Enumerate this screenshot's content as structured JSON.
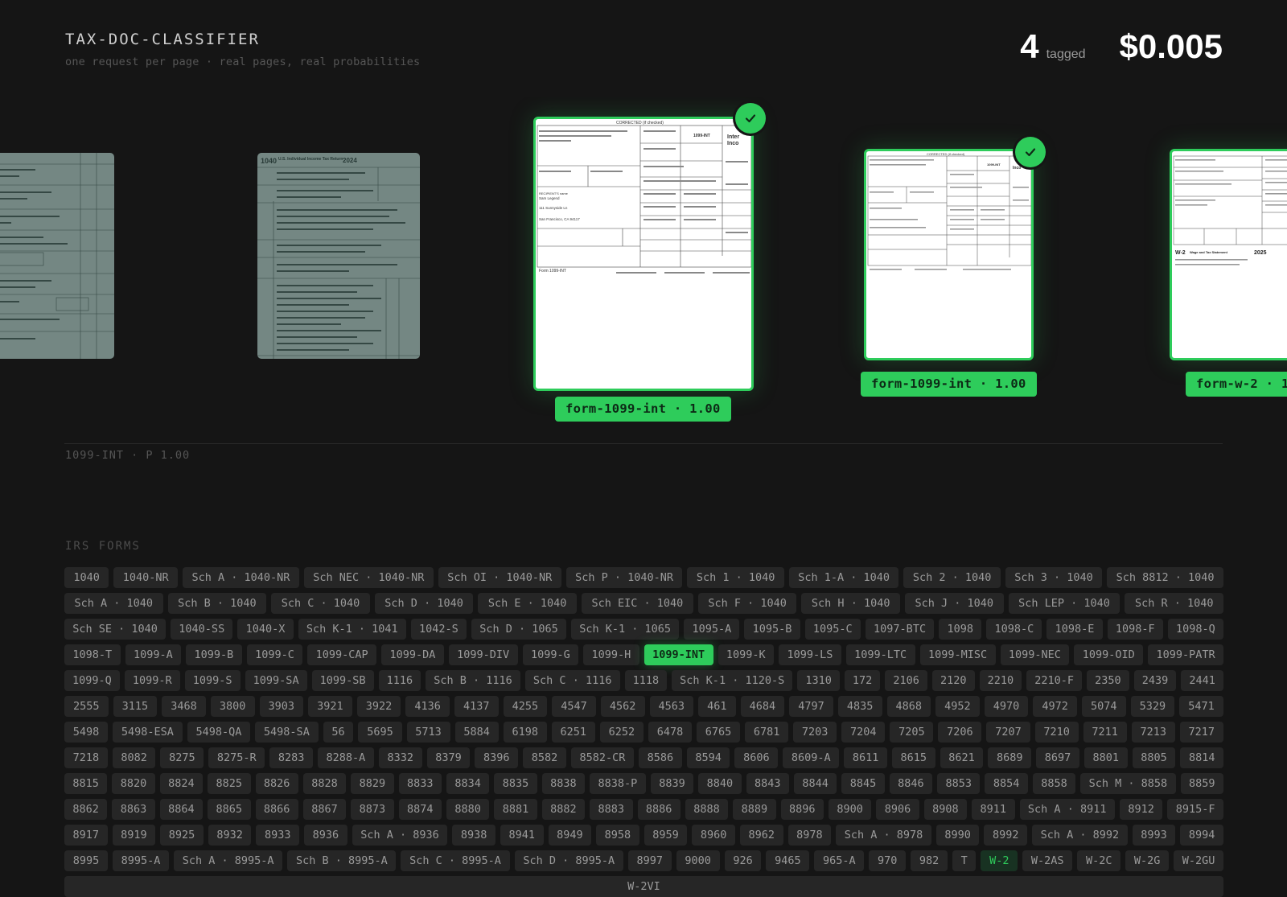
{
  "header": {
    "title": "TAX-DOC-CLASSIFIER",
    "subtitle": "one request per page · real pages, real probabilities",
    "tagged_count": "4",
    "tagged_label": "tagged",
    "cost": "$0.005"
  },
  "carousel": {
    "pages": [
      {
        "state": "dim",
        "form": "1040 page"
      },
      {
        "state": "dim",
        "form": "1040",
        "heading": "U.S. Individual Income Tax Return",
        "year": "2024"
      },
      {
        "state": "tagged-selected",
        "form": "1099-INT",
        "label": "form-1099-int · 1.00",
        "recipient": "Sam Legend",
        "street": "111 Sunnyside Ln",
        "city": "San Francisco, CA 94117"
      },
      {
        "state": "tagged",
        "form": "1099-INT",
        "label": "form-1099-int · 1.00"
      },
      {
        "state": "tagged",
        "form": "W-2",
        "label": "form-w-2 · 1",
        "heading": "Wage and Tax Statement",
        "year": "2025"
      }
    ]
  },
  "selected_readout": "1099-INT · P 1.00",
  "forms_heading": "IRS FORMS",
  "colors": {
    "accent": "#2ecc5b",
    "background": "#151515",
    "chip": "#262626"
  },
  "forms": [
    {
      "label": "1040"
    },
    {
      "label": "1040-NR"
    },
    {
      "label": "Sch A · 1040-NR"
    },
    {
      "label": "Sch NEC · 1040-NR"
    },
    {
      "label": "Sch OI · 1040-NR"
    },
    {
      "label": "Sch P · 1040-NR"
    },
    {
      "label": "Sch 1 · 1040"
    },
    {
      "label": "Sch 1-A · 1040"
    },
    {
      "label": "Sch 2 · 1040"
    },
    {
      "label": "Sch 3 · 1040"
    },
    {
      "label": "Sch 8812 · 1040"
    },
    {
      "label": "Sch A · 1040"
    },
    {
      "label": "Sch B · 1040"
    },
    {
      "label": "Sch C · 1040"
    },
    {
      "label": "Sch D · 1040"
    },
    {
      "label": "Sch E · 1040"
    },
    {
      "label": "Sch EIC · 1040"
    },
    {
      "label": "Sch F · 1040"
    },
    {
      "label": "Sch H · 1040"
    },
    {
      "label": "Sch J · 1040"
    },
    {
      "label": "Sch LEP · 1040"
    },
    {
      "label": "Sch R · 1040"
    },
    {
      "label": "Sch SE · 1040"
    },
    {
      "label": "1040-SS"
    },
    {
      "label": "1040-X"
    },
    {
      "label": "Sch K-1 · 1041"
    },
    {
      "label": "1042-S"
    },
    {
      "label": "Sch D · 1065"
    },
    {
      "label": "Sch K-1 · 1065"
    },
    {
      "label": "1095-A"
    },
    {
      "label": "1095-B"
    },
    {
      "label": "1095-C"
    },
    {
      "label": "1097-BTC"
    },
    {
      "label": "1098"
    },
    {
      "label": "1098-C"
    },
    {
      "label": "1098-E"
    },
    {
      "label": "1098-F"
    },
    {
      "label": "1098-Q"
    },
    {
      "label": "1098-T"
    },
    {
      "label": "1099-A"
    },
    {
      "label": "1099-B"
    },
    {
      "label": "1099-C"
    },
    {
      "label": "1099-CAP"
    },
    {
      "label": "1099-DA"
    },
    {
      "label": "1099-DIV"
    },
    {
      "label": "1099-G"
    },
    {
      "label": "1099-H"
    },
    {
      "label": "1099-INT",
      "state": "active"
    },
    {
      "label": "1099-K"
    },
    {
      "label": "1099-LS"
    },
    {
      "label": "1099-LTC"
    },
    {
      "label": "1099-MISC"
    },
    {
      "label": "1099-NEC"
    },
    {
      "label": "1099-OID"
    },
    {
      "label": "1099-PATR"
    },
    {
      "label": "1099-Q"
    },
    {
      "label": "1099-R"
    },
    {
      "label": "1099-S"
    },
    {
      "label": "1099-SA"
    },
    {
      "label": "1099-SB"
    },
    {
      "label": "1116"
    },
    {
      "label": "Sch B · 1116"
    },
    {
      "label": "Sch C · 1116"
    },
    {
      "label": "1118"
    },
    {
      "label": "Sch K-1 · 1120-S"
    },
    {
      "label": "1310"
    },
    {
      "label": "172"
    },
    {
      "label": "2106"
    },
    {
      "label": "2120"
    },
    {
      "label": "2210"
    },
    {
      "label": "2210-F"
    },
    {
      "label": "2350"
    },
    {
      "label": "2439"
    },
    {
      "label": "2441"
    },
    {
      "label": "2555"
    },
    {
      "label": "3115"
    },
    {
      "label": "3468"
    },
    {
      "label": "3800"
    },
    {
      "label": "3903"
    },
    {
      "label": "3921"
    },
    {
      "label": "3922"
    },
    {
      "label": "4136"
    },
    {
      "label": "4137"
    },
    {
      "label": "4255"
    },
    {
      "label": "4547"
    },
    {
      "label": "4562"
    },
    {
      "label": "4563"
    },
    {
      "label": "461"
    },
    {
      "label": "4684"
    },
    {
      "label": "4797"
    },
    {
      "label": "4835"
    },
    {
      "label": "4868"
    },
    {
      "label": "4952"
    },
    {
      "label": "4970"
    },
    {
      "label": "4972"
    },
    {
      "label": "5074"
    },
    {
      "label": "5329"
    },
    {
      "label": "5471"
    },
    {
      "label": "5498"
    },
    {
      "label": "5498-ESA"
    },
    {
      "label": "5498-QA"
    },
    {
      "label": "5498-SA"
    },
    {
      "label": "56"
    },
    {
      "label": "5695"
    },
    {
      "label": "5713"
    },
    {
      "label": "5884"
    },
    {
      "label": "6198"
    },
    {
      "label": "6251"
    },
    {
      "label": "6252"
    },
    {
      "label": "6478"
    },
    {
      "label": "6765"
    },
    {
      "label": "6781"
    },
    {
      "label": "7203"
    },
    {
      "label": "7204"
    },
    {
      "label": "7205"
    },
    {
      "label": "7206"
    },
    {
      "label": "7207"
    },
    {
      "label": "7210"
    },
    {
      "label": "7211"
    },
    {
      "label": "7213"
    },
    {
      "label": "7217"
    },
    {
      "label": "7218"
    },
    {
      "label": "8082"
    },
    {
      "label": "8275"
    },
    {
      "label": "8275-R"
    },
    {
      "label": "8283"
    },
    {
      "label": "8288-A"
    },
    {
      "label": "8332"
    },
    {
      "label": "8379"
    },
    {
      "label": "8396"
    },
    {
      "label": "8582"
    },
    {
      "label": "8582-CR"
    },
    {
      "label": "8586"
    },
    {
      "label": "8594"
    },
    {
      "label": "8606"
    },
    {
      "label": "8609-A"
    },
    {
      "label": "8611"
    },
    {
      "label": "8615"
    },
    {
      "label": "8621"
    },
    {
      "label": "8689"
    },
    {
      "label": "8697"
    },
    {
      "label": "8801"
    },
    {
      "label": "8805"
    },
    {
      "label": "8814"
    },
    {
      "label": "8815"
    },
    {
      "label": "8820"
    },
    {
      "label": "8824"
    },
    {
      "label": "8825"
    },
    {
      "label": "8826"
    },
    {
      "label": "8828"
    },
    {
      "label": "8829"
    },
    {
      "label": "8833"
    },
    {
      "label": "8834"
    },
    {
      "label": "8835"
    },
    {
      "label": "8838"
    },
    {
      "label": "8838-P"
    },
    {
      "label": "8839"
    },
    {
      "label": "8840"
    },
    {
      "label": "8843"
    },
    {
      "label": "8844"
    },
    {
      "label": "8845"
    },
    {
      "label": "8846"
    },
    {
      "label": "8853"
    },
    {
      "label": "8854"
    },
    {
      "label": "8858"
    },
    {
      "label": "Sch M · 8858"
    },
    {
      "label": "8859"
    },
    {
      "label": "8862"
    },
    {
      "label": "8863"
    },
    {
      "label": "8864"
    },
    {
      "label": "8865"
    },
    {
      "label": "8866"
    },
    {
      "label": "8867"
    },
    {
      "label": "8873"
    },
    {
      "label": "8874"
    },
    {
      "label": "8880"
    },
    {
      "label": "8881"
    },
    {
      "label": "8882"
    },
    {
      "label": "8883"
    },
    {
      "label": "8886"
    },
    {
      "label": "8888"
    },
    {
      "label": "8889"
    },
    {
      "label": "8896"
    },
    {
      "label": "8900"
    },
    {
      "label": "8906"
    },
    {
      "label": "8908"
    },
    {
      "label": "8911"
    },
    {
      "label": "Sch A · 8911"
    },
    {
      "label": "8912"
    },
    {
      "label": "8915-F"
    },
    {
      "label": "8917"
    },
    {
      "label": "8919"
    },
    {
      "label": "8925"
    },
    {
      "label": "8932"
    },
    {
      "label": "8933"
    },
    {
      "label": "8936"
    },
    {
      "label": "Sch A · 8936"
    },
    {
      "label": "8938"
    },
    {
      "label": "8941"
    },
    {
      "label": "8949"
    },
    {
      "label": "8958"
    },
    {
      "label": "8959"
    },
    {
      "label": "8960"
    },
    {
      "label": "8962"
    },
    {
      "label": "8978"
    },
    {
      "label": "Sch A · 8978"
    },
    {
      "label": "8990"
    },
    {
      "label": "8992"
    },
    {
      "label": "Sch A · 8992"
    },
    {
      "label": "8993"
    },
    {
      "label": "8994"
    },
    {
      "label": "8995"
    },
    {
      "label": "8995-A"
    },
    {
      "label": "Sch A · 8995-A"
    },
    {
      "label": "Sch B · 8995-A"
    },
    {
      "label": "Sch C · 8995-A"
    },
    {
      "label": "Sch D · 8995-A"
    },
    {
      "label": "8997"
    },
    {
      "label": "9000"
    },
    {
      "label": "926"
    },
    {
      "label": "9465"
    },
    {
      "label": "965-A"
    },
    {
      "label": "970"
    },
    {
      "label": "982"
    },
    {
      "label": "T"
    },
    {
      "label": "W-2",
      "state": "partial"
    },
    {
      "label": "W-2AS"
    },
    {
      "label": "W-2C"
    },
    {
      "label": "W-2G"
    },
    {
      "label": "W-2GU"
    },
    {
      "label": "W-2VI"
    }
  ]
}
